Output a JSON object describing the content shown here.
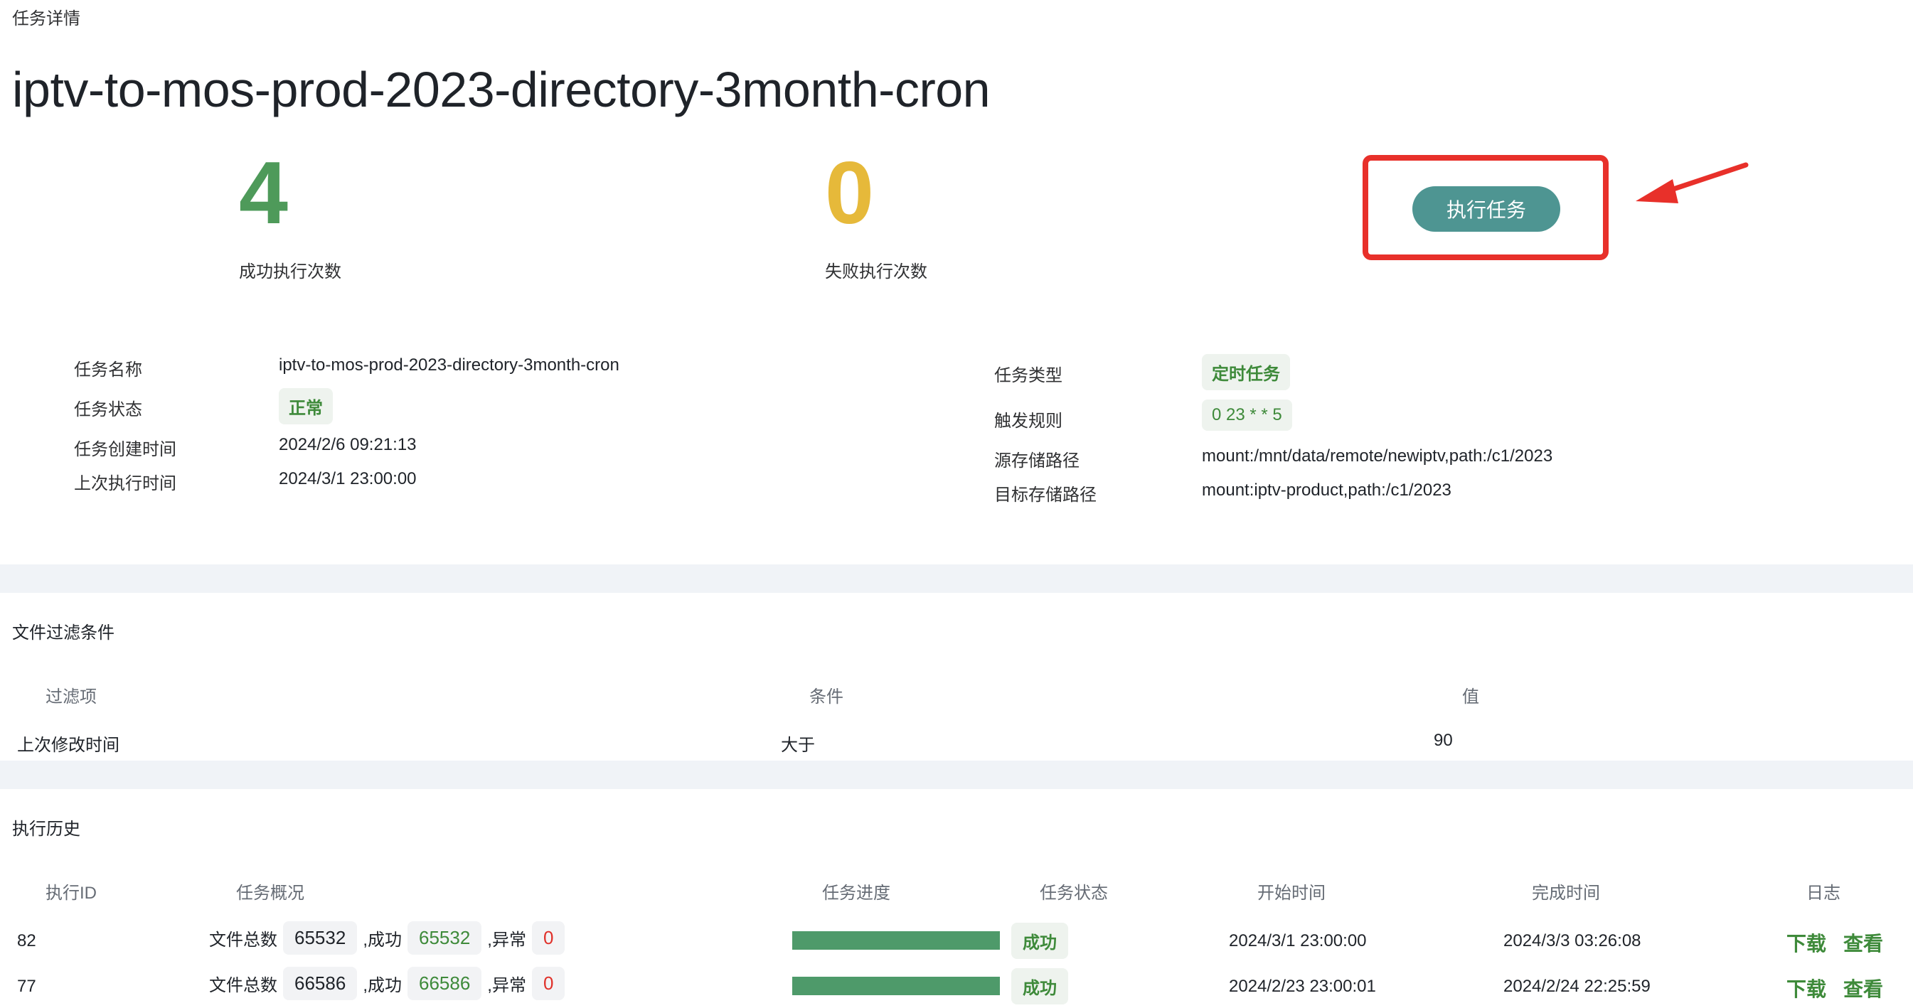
{
  "breadcrumb": "任务详情",
  "task_title": "iptv-to-mos-prod-2023-directory-3month-cron",
  "stats": {
    "success_count": "4",
    "success_label": "成功执行次数",
    "fail_count": "0",
    "fail_label": "失败执行次数"
  },
  "run_button": "执行任务",
  "info_left": [
    {
      "label": "任务名称",
      "value": "iptv-to-mos-prod-2023-directory-3month-cron"
    },
    {
      "label": "任务状态",
      "value": "正常"
    },
    {
      "label": "任务创建时间",
      "value": "2024/2/6 09:21:13"
    },
    {
      "label": "上次执行时间",
      "value": "2024/3/1 23:00:00"
    }
  ],
  "info_right": [
    {
      "label": "任务类型",
      "value": "定时任务"
    },
    {
      "label": "触发规则",
      "value": "0 23 * * 5"
    },
    {
      "label": "源存储路径",
      "value": "mount:/mnt/data/remote/newiptv,path:/c1/2023"
    },
    {
      "label": "目标存储路径",
      "value": "mount:iptv-product,path:/c1/2023"
    }
  ],
  "filter": {
    "title": "文件过滤条件",
    "headers": [
      "过滤项",
      "条件",
      "值"
    ],
    "rows": [
      {
        "item": "上次修改时间",
        "condition": "大于",
        "value": "90"
      }
    ]
  },
  "history": {
    "title": "执行历史",
    "headers": [
      "执行ID",
      "任务概况",
      "任务进度",
      "任务状态",
      "开始时间",
      "完成时间",
      "日志"
    ],
    "summary_labels": {
      "total": "文件总数",
      "success": ",成功",
      "error": ",异常"
    },
    "rows": [
      {
        "id": "82",
        "total": "65532",
        "success": "65532",
        "error": "0",
        "progress": 1.0,
        "status": "成功",
        "start": "2024/3/1 23:00:00",
        "end": "2024/3/3 03:26:08",
        "download": "下载",
        "view": "查看"
      },
      {
        "id": "77",
        "total": "66586",
        "success": "66586",
        "error": "0",
        "progress": 1.0,
        "status": "成功",
        "start": "2024/2/23 23:00:01",
        "end": "2024/2/24 22:25:59",
        "download": "下载",
        "view": "查看"
      }
    ]
  },
  "colors": {
    "success": "#4e9a5a",
    "warning": "#e6b93a",
    "primary_button": "#4e9592",
    "highlight": "#e8302a",
    "tag_text": "#3e8a3a"
  }
}
